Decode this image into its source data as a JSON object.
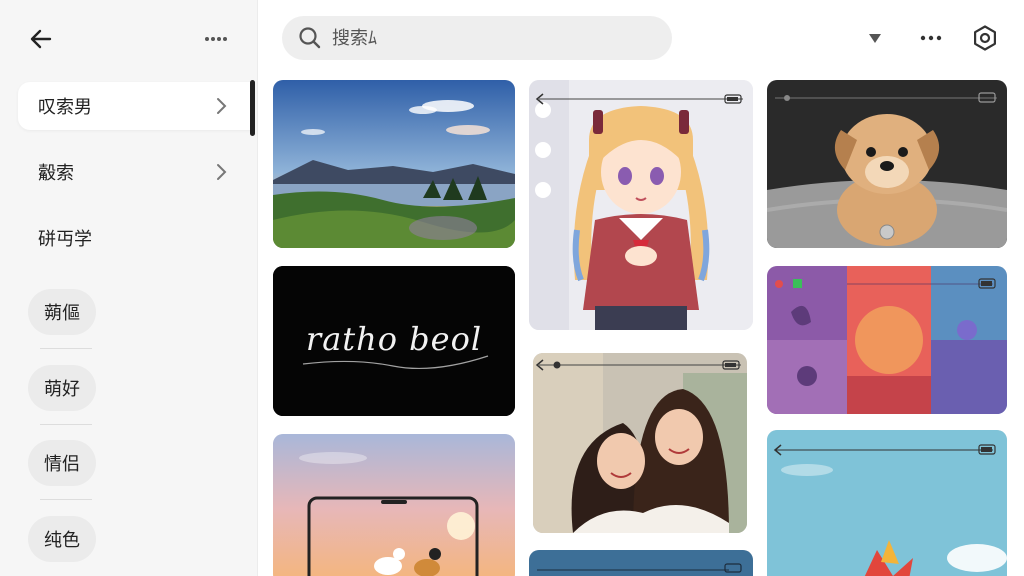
{
  "sidebar": {
    "items": [
      {
        "label": "叹索男"
      },
      {
        "label": "觳索"
      },
      {
        "label": "硑丏学"
      }
    ],
    "tags": [
      {
        "label": "蒴傴"
      },
      {
        "label": "萌好"
      },
      {
        "label": "情侣"
      },
      {
        "label": "纯色"
      }
    ]
  },
  "search": {
    "placeholder": "搜索ﾑ"
  },
  "cards": {
    "calligraphy_text": "ratho beol"
  },
  "icons": {
    "back": "back-arrow-icon",
    "more": "more-dots-icon",
    "search": "search-icon",
    "filter": "dropdown-triangle-icon",
    "settings": "settings-gear-icon"
  },
  "colors": {
    "sidebar_bg": "#f6f6f6",
    "pill_bg": "#ebebeb",
    "search_bg": "#eeeeee",
    "text": "#222222"
  }
}
